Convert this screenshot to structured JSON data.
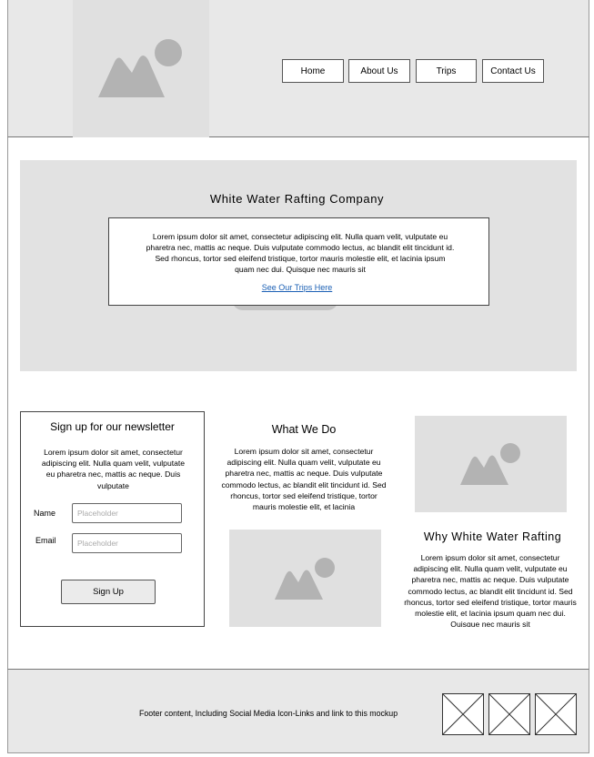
{
  "header": {
    "logo_icon": "image-placeholder-icon",
    "nav": [
      "Home",
      "About Us",
      "Trips",
      "Contact Us"
    ]
  },
  "hero": {
    "title": "White Water Rafting Company",
    "text": "Lorem ipsum dolor sit amet, consectetur adipiscing elit. Nulla quam velit, vulputate eu pharetra nec, mattis ac neque. Duis vulputate commodo lectus, ac blandit elit tincidunt id. Sed rhoncus, tortor sed eleifend tristique, tortor mauris molestie elit, et lacinia ipsum quam nec dui. Quisque nec mauris sit",
    "link": "See Our Trips Here"
  },
  "newsletter": {
    "title": "Sign up for our newsletter",
    "text": "Lorem ipsum dolor sit amet, consectetur adipiscing elit. Nulla quam velit, vulputate eu pharetra nec, mattis ac neque. Duis vulputate",
    "name_label": "Name",
    "name_placeholder": "Placeholder",
    "email_label": "Email",
    "email_placeholder": "Placeholder",
    "button": "Sign Up"
  },
  "what_we_do": {
    "title": "What We Do",
    "text": "Lorem ipsum dolor sit amet, consectetur adipiscing elit. Nulla quam velit, vulputate eu pharetra nec, mattis ac neque. Duis vulputate commodo lectus, ac blandit elit tincidunt id. Sed rhoncus, tortor sed eleifend tristique, tortor mauris molestie elit, et lacinia"
  },
  "why": {
    "title": "Why White Water Rafting",
    "text": "Lorem ipsum dolor sit amet, consectetur adipiscing elit. Nulla quam velit, vulputate eu pharetra nec, mattis ac neque. Duis vulputate commodo lectus, ac blandit elit tincidunt id. Sed rhoncus, tortor sed eleifend tristique, tortor mauris molestie elit, et lacinia ipsum quam nec dui. Quisque nec mauris sit"
  },
  "footer": {
    "text": "Footer content, Including Social Media Icon-Links and link to this mockup",
    "social_icons": [
      "social-link-placeholder-icon",
      "social-link-placeholder-icon",
      "social-link-placeholder-icon"
    ]
  }
}
